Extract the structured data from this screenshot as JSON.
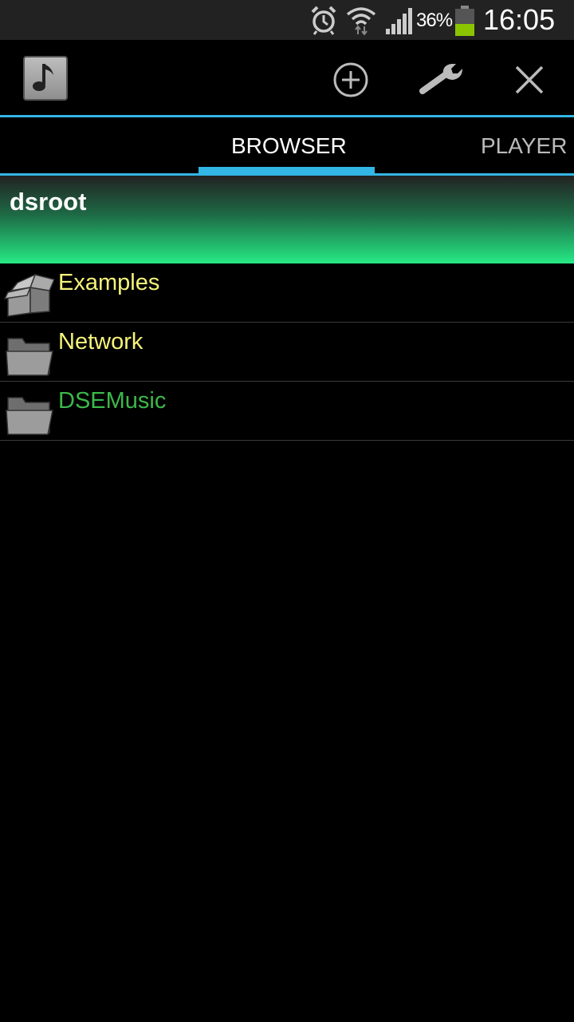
{
  "status_bar": {
    "icons": [
      "alarm-icon",
      "wifi-icon",
      "signal-icon",
      "battery-icon"
    ],
    "battery_percent": "36%",
    "time": "16:05",
    "battery_color": "#8bc400"
  },
  "action_bar": {
    "app_icon": "music-note-icon",
    "actions": [
      "add-circle-icon",
      "wrench-icon",
      "close-icon"
    ],
    "accent_color": "#33b5e5"
  },
  "tabs": [
    {
      "label": "BROWSER",
      "active": true
    },
    {
      "label": "PLAYER",
      "active": false
    }
  ],
  "path_header": {
    "title": "dsroot",
    "gradient": [
      "#222222",
      "#26ea84"
    ]
  },
  "items": [
    {
      "label": "Examples",
      "icon": "open-box-icon",
      "color": "#f5f37a"
    },
    {
      "label": "Network",
      "icon": "folder-icon",
      "color": "#f5f37a"
    },
    {
      "label": "DSEMusic",
      "icon": "folder-icon",
      "color": "#3cb84a"
    }
  ]
}
